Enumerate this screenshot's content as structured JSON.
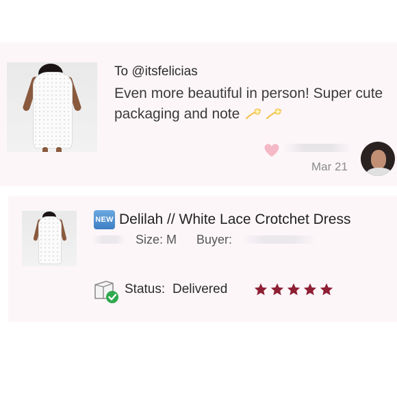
{
  "note": {
    "recipient": "To @itsfelicias",
    "message": "Even more beautiful in person! Super cute packaging and note",
    "message_emoji": [
      "sparkle-icon",
      "sparkle-icon"
    ],
    "date": "Mar 21",
    "heart_color": "#f5b8c7"
  },
  "order": {
    "badge": "NEW",
    "title": "Delilah // White Lace Crotchet Dress",
    "size": "Size: M",
    "buyer_label": "Buyer:",
    "status_label": "Status:",
    "status_value": "Delivered",
    "rating": 5,
    "star_color": "#8e1f34",
    "check_color": "#2fa84f"
  },
  "colors": {
    "card_background": "#fcf6f9",
    "badge_blue": "#3d7fc4"
  }
}
